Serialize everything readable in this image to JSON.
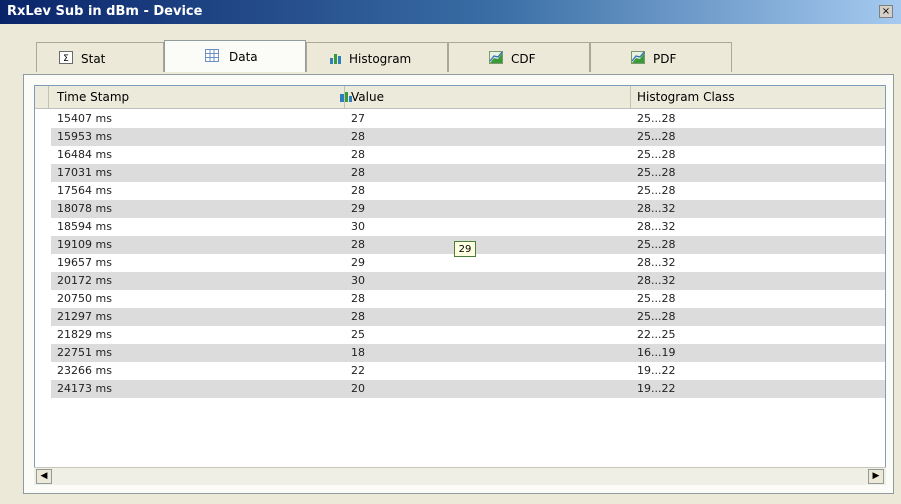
{
  "window": {
    "title": "RxLev Sub in dBm - Device",
    "close_label": "×"
  },
  "tabs": [
    {
      "label": "Stat",
      "icon": "sigma-icon"
    },
    {
      "label": "Data",
      "icon": "grid-icon"
    },
    {
      "label": "Histogram",
      "icon": "histogram-icon"
    },
    {
      "label": "CDF",
      "icon": "chart-icon"
    },
    {
      "label": "PDF",
      "icon": "chart-icon"
    }
  ],
  "active_tab": "Data",
  "table": {
    "columns": [
      "Time Stamp",
      "Value",
      "Histogram Class"
    ],
    "rows": [
      {
        "time": "15407 ms",
        "value": "27",
        "class": "25...28"
      },
      {
        "time": "15953 ms",
        "value": "28",
        "class": "25...28"
      },
      {
        "time": "16484 ms",
        "value": "28",
        "class": "25...28"
      },
      {
        "time": "17031 ms",
        "value": "28",
        "class": "25...28"
      },
      {
        "time": "17564 ms",
        "value": "28",
        "class": "25...28"
      },
      {
        "time": "18078 ms",
        "value": "29",
        "class": "28...32"
      },
      {
        "time": "18594 ms",
        "value": "30",
        "class": "28...32"
      },
      {
        "time": "19109 ms",
        "value": "28",
        "class": "25...28"
      },
      {
        "time": "19657 ms",
        "value": "29",
        "class": "28...32"
      },
      {
        "time": "20172 ms",
        "value": "30",
        "class": "28...32"
      },
      {
        "time": "20750 ms",
        "value": "28",
        "class": "25...28"
      },
      {
        "time": "21297 ms",
        "value": "28",
        "class": "25...28"
      },
      {
        "time": "21829 ms",
        "value": "25",
        "class": "22...25"
      },
      {
        "time": "22751 ms",
        "value": "18",
        "class": "16...19"
      },
      {
        "time": "23266 ms",
        "value": "22",
        "class": "19...22"
      },
      {
        "time": "24173 ms",
        "value": "20",
        "class": "19...22"
      }
    ]
  },
  "tooltip": {
    "text": "29"
  },
  "scrollbar": {
    "left_arrow": "◀",
    "right_arrow": "▶"
  }
}
